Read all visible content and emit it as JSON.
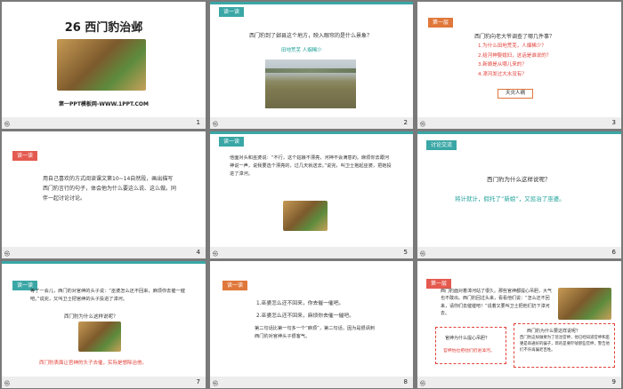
{
  "slides": [
    {
      "page": "1",
      "mark": "㉿",
      "title": "26 西门豹治邺",
      "subtitle": "第一PPT模板网-WWW.1PPT.COM"
    },
    {
      "page": "2",
      "mark": "㉿",
      "tag": "读一读",
      "question": "西门豹到了邺县这个地方，映入眼帘的是什么景象？",
      "caption": "田地荒芜    人烟稀少"
    },
    {
      "page": "3",
      "mark": "㉿",
      "tag": "第一层",
      "question": "西门豹向老大爷调查了哪几件事？",
      "items": [
        "1.为什么田地荒芜，人烟稀少？",
        "2.给河神娶媳妇，这话是谁说的？",
        "3.新娘是从哪儿来的？",
        "4.漳河发过大水没有？"
      ],
      "button": "天灾人祸"
    },
    {
      "page": "4",
      "mark": "㉿",
      "tag": "读一读",
      "text": "用自己喜欢的方式阅读课文第10~14自然段，画出描写西门豹言行的句子，体会他为什么要这么说、这么做。同伴一起讨论讨论。"
    },
    {
      "page": "5",
      "mark": "㉿",
      "tag": "读一读",
      "text": "他面对头和巫婆说：“不行，这个姑娘不漂亮，河神不会满意的。麻烦你去跟河神说一声，说我要选个漂亮的，过几天就送去。”说完，叫卫士抱起巫婆，把她投进了漳河。"
    },
    {
      "page": "6",
      "mark": "㉿",
      "tag": "讨论交流",
      "question": "西门豹为什么这样说呢？",
      "answer": "将计就计，假托了“新娘”，又惩治了巫婆。"
    },
    {
      "page": "7",
      "mark": "㉿",
      "tag": "读一读",
      "text": "等了一会儿，西门豹对官绅的头子说：“巫婆怎么还不回来，麻烦你去催一催吧。”说完，又叫卫士把官绅的头子投进了漳河。",
      "question": "西门豹为什么这样说呢？",
      "answer": "西门豹表面让官绅的头子去催，实际是想除治他。"
    },
    {
      "page": "8",
      "mark": "㉿",
      "tag": "读一读",
      "lines": [
        "1.巫婆怎么还不回来，你去催一催吧。",
        "2.巫婆怎么还不回来，麻烦你去催一催吧。"
      ],
      "note": "第二句话比第一句多一个“麻烦”，第二句话，因为是很讽刺西门豹对官绅头子很客气。"
    },
    {
      "page": "9",
      "mark": "㉿",
      "tag": "第一层",
      "text": "西门豹面对着漳河站了很久。那些官绅都提心吊胆，大气也不敢出。西门豹回过头来，看看他们说：“怎么还不回来，请你们去催催吧！”说着又要叫卫士把他们扔下漳河去。",
      "box1_title": "官绅为什么提心吊胆？",
      "box1_text": "官绅怕也把他们扔进漳河。",
      "box2_title": "西门豹为什么要这样说呢？",
      "box2_text": "西门豹这样做要为了惩治官绅，他已经知道官绅和巫婆是串通好的骗子，目的是要吓唬那些官绅，警告他们不许再骗老百姓。"
    }
  ]
}
